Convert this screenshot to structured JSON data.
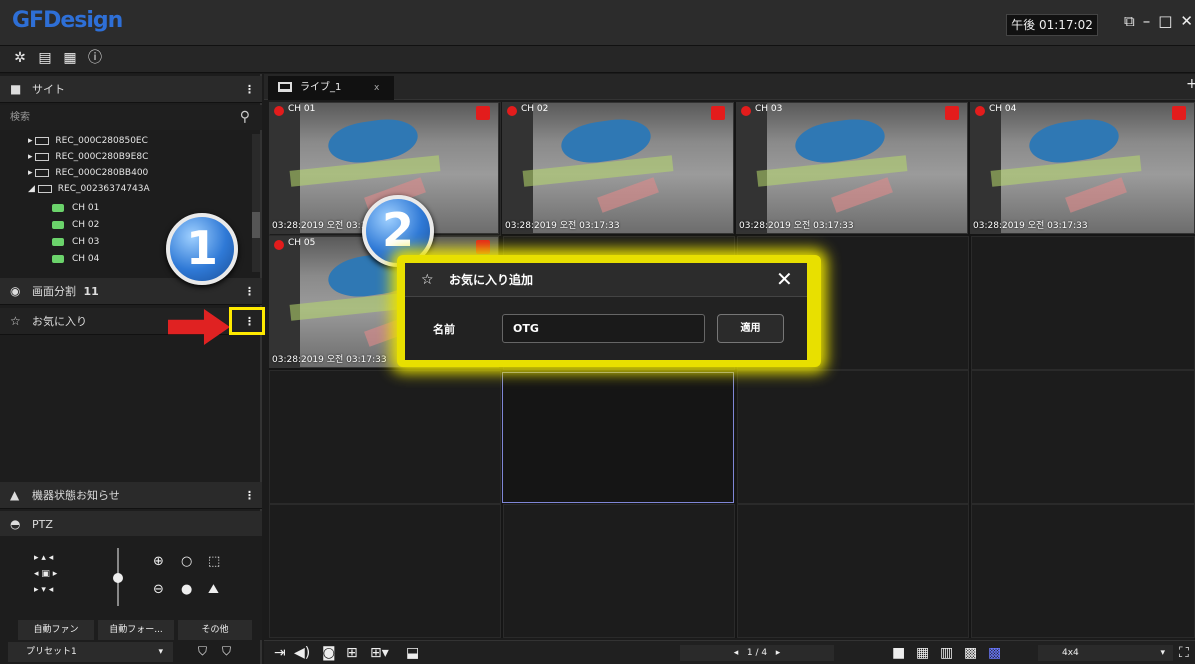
{
  "app": {
    "logo": "GFDesign",
    "clock": "午後 01:17:02"
  },
  "window_controls": {
    "restore": "⧉",
    "minimize": "–",
    "maximize": "□",
    "close": "✕"
  },
  "toolbar": {
    "icons": [
      "gear-icon",
      "clipboard-icon",
      "list-icon",
      "info-icon"
    ]
  },
  "sidebar": {
    "site_header": "サイト",
    "search_label": "検索",
    "devices": [
      "REC_000C280850EC",
      "REC_000C280B9E8C",
      "REC_000C280BB400",
      "REC_00236374743A"
    ],
    "channels": [
      "CH 01",
      "CH 02",
      "CH 03",
      "CH 04"
    ],
    "split_label": "画面分割",
    "split_count": "11",
    "favorites_label": "お気に入り",
    "device_status_label": "機器状態お知らせ",
    "ptz_label": "PTZ",
    "buttons": {
      "auto_fan": "自動ファン",
      "auto_focus": "自動フォー...",
      "other": "その他"
    },
    "preset": "プリセット1"
  },
  "tab": {
    "label": "ライブ_1",
    "close": "x"
  },
  "cameras": [
    {
      "label": "CH 01",
      "stamp": "03:28:2019 오전 03:17:33"
    },
    {
      "label": "CH 02",
      "stamp": "03:28:2019 오전 03:17:33"
    },
    {
      "label": "CH 03",
      "stamp": "03:28:2019 오전 03:17:33"
    },
    {
      "label": "CH 04",
      "stamp": "03:28:2019 오전 03:17:33"
    },
    {
      "label": "CH 05",
      "stamp": "03:28:2019 오전 03:17:33"
    }
  ],
  "dialog": {
    "title": "お気に入り追加",
    "name_label": "名前",
    "name_value": "OTG",
    "apply_label": "適用"
  },
  "callouts": {
    "one": "1",
    "two": "2"
  },
  "bottom": {
    "page": "1 / 4",
    "layout": "4x4"
  },
  "colors": {
    "accent": "#2e6fd6",
    "record": "#e31c1c",
    "highlight": "#ffea00",
    "arrow": "#e02222"
  }
}
